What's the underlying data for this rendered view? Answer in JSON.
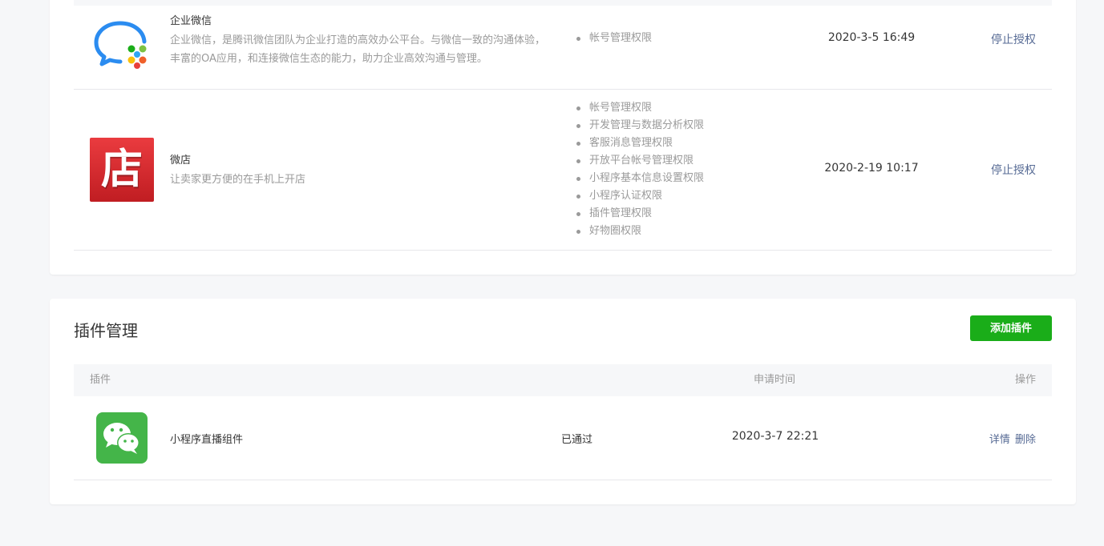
{
  "authorized_apps": [
    {
      "name": "企业微信",
      "description": "企业微信，是腾讯微信团队为企业打造的高效办公平台。与微信一致的沟通体验，丰富的OA应用，和连接微信生态的能力，助力企业高效沟通与管理。",
      "permissions": [
        "帐号管理权限"
      ],
      "time": "2020-3-5 16:49",
      "action": "停止授权"
    },
    {
      "name": "微店",
      "description": "让卖家更方便的在手机上开店",
      "logo_char": "店",
      "permissions": [
        "帐号管理权限",
        "开发管理与数据分析权限",
        "客服消息管理权限",
        "开放平台帐号管理权限",
        "小程序基本信息设置权限",
        "小程序认证权限",
        "插件管理权限",
        "好物圈权限"
      ],
      "time": "2020-2-19 10:17",
      "action": "停止授权"
    }
  ],
  "plugin_section": {
    "title": "插件管理",
    "add_button": "添加插件",
    "columns": {
      "plugin": "插件",
      "apply_time": "申请时间",
      "operation": "操作"
    },
    "rows": [
      {
        "name": "小程序直播组件",
        "status": "已通过",
        "time": "2020-3-7 22:21",
        "actions": {
          "detail": "详情",
          "delete": "删除"
        }
      }
    ]
  },
  "colors": {
    "accent_green": "#1aad19",
    "link": "#576b95",
    "wechat_green": "#44b549",
    "weidian_red": "#d8262d"
  },
  "icons": {
    "qywx": "wecom-logo-icon",
    "weidian": "weidian-logo-icon",
    "plugin": "wechat-logo-icon"
  }
}
